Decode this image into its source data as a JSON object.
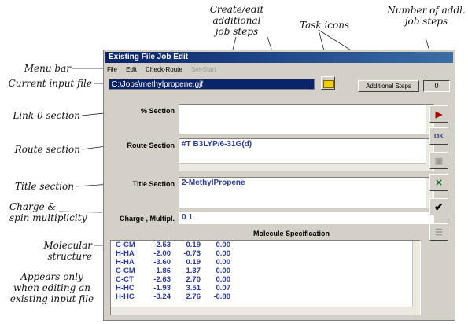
{
  "annotations": {
    "create_edit": [
      "Create/edit",
      "additional",
      "job steps"
    ],
    "task_icons": "Task icons",
    "num_steps": [
      "Number of addl.",
      "job steps"
    ],
    "menu_bar": "Menu bar",
    "current_input": "Current input file",
    "link0": "Link 0 section",
    "route": "Route section",
    "title": "Title section",
    "charge": [
      "Charge &",
      "spin multiplicity"
    ],
    "molecular": "Molecular structure",
    "appears": [
      "Appears only",
      "when editing an",
      "existing input file"
    ]
  },
  "window": {
    "title": "Existing File Job Edit",
    "menu": [
      "File",
      "Edit",
      "Check-Route",
      "Set-Start"
    ],
    "input_file": "C:\\Jobs\\methylpropene.gjf",
    "additional_steps": "Additional Steps",
    "step_count": "0",
    "sections": {
      "percent_label": "% Section",
      "percent_value": "",
      "route_label": "Route Section",
      "route_value": "#T B3LYP/6-31G(d)",
      "title_label": "Title Section",
      "title_value": "2-MethylPropene",
      "charge_label": "Charge , Multipl.",
      "charge_value": "0 1"
    },
    "molecule_heading": "Molecule Specification",
    "molecule_rows": [
      [
        "C-CM",
        "-2.53",
        "0.19",
        "0.00"
      ],
      [
        "H-HA",
        "-2.00",
        "-0.73",
        "0.00"
      ],
      [
        "H-HA",
        "-3.60",
        "0.19",
        "0.00"
      ],
      [
        "C-CM",
        "-1.86",
        "1.37",
        "0.00"
      ],
      [
        "C-CT",
        "-2.63",
        "2.70",
        "0.00"
      ],
      [
        "H-HC",
        "-1.93",
        "3.51",
        "0.07"
      ],
      [
        "H-HC",
        "-3.24",
        "2.76",
        "-0.88"
      ]
    ]
  }
}
